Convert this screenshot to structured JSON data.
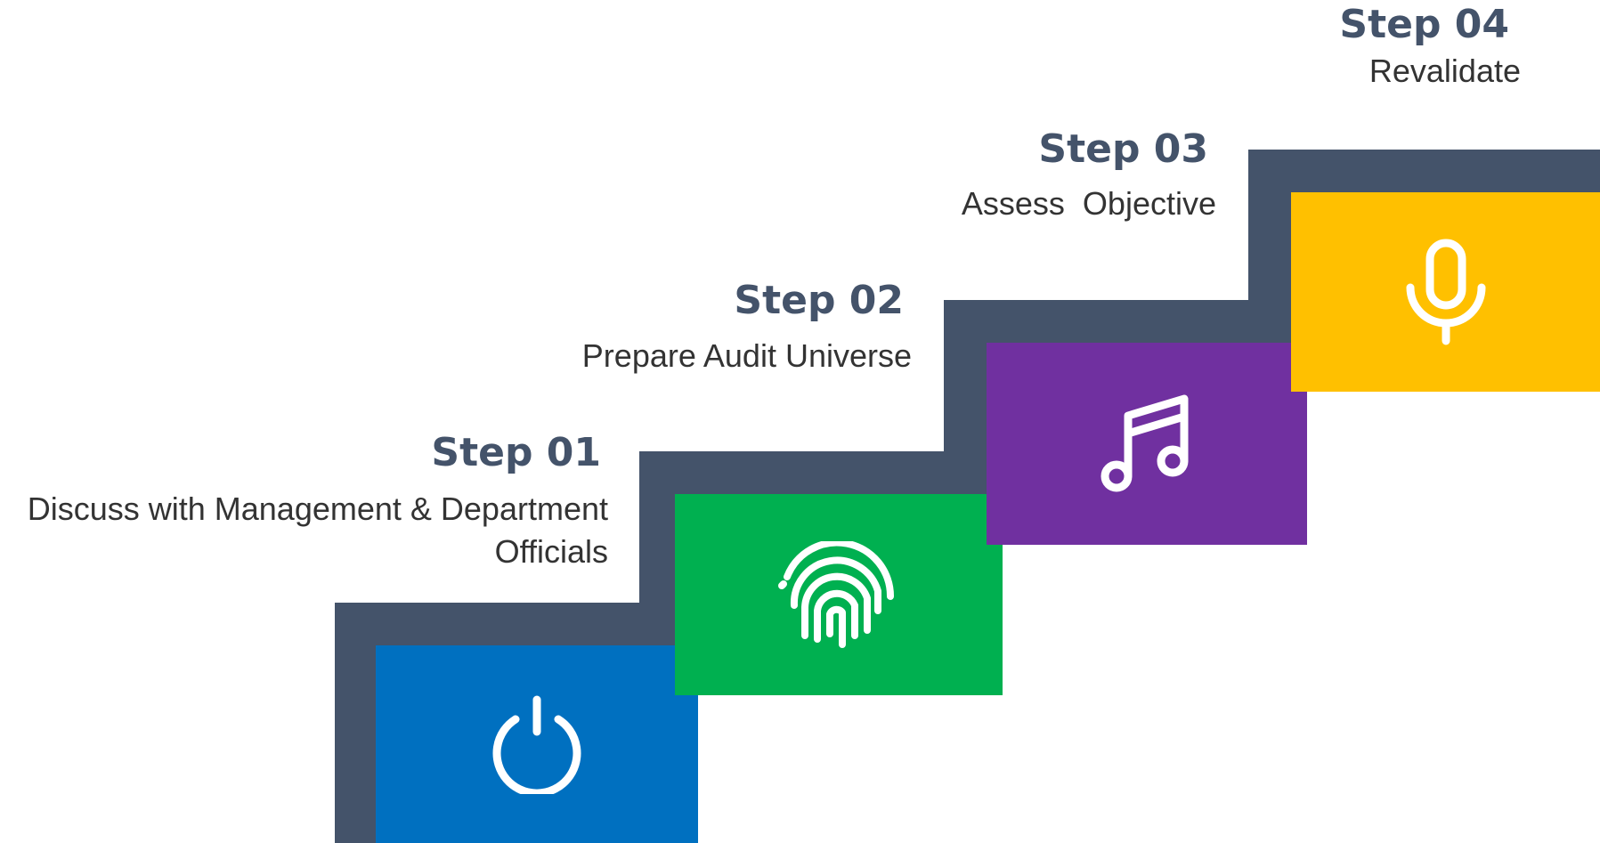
{
  "steps": [
    {
      "title": "Step 01",
      "description_line1": "Discuss with Management & Department",
      "description_line2": "Officials",
      "icon": "power-icon",
      "color": "#0070c0"
    },
    {
      "title": "Step 02",
      "description": "Prepare Audit Universe",
      "icon": "fingerprint-icon",
      "color": "#00b050"
    },
    {
      "title": "Step 03",
      "description": "Assess  Objective",
      "icon": "music-note-icon",
      "color": "#7030a0"
    },
    {
      "title": "Step 04",
      "description": "Revalidate",
      "icon": "microphone-icon",
      "color": "#ffc000"
    }
  ],
  "stair_color": "#44536a"
}
